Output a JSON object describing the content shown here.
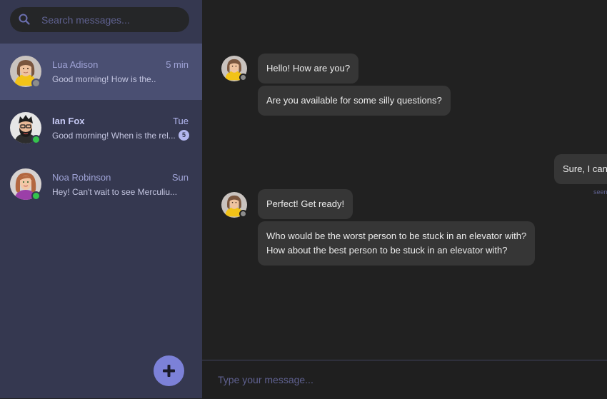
{
  "search": {
    "placeholder": "Search messages..."
  },
  "conversations": [
    {
      "name": "Lua Adison",
      "snippet": "Good morning! How is the..",
      "time": "5 min",
      "status": "offline",
      "unread": ""
    },
    {
      "name": "Ian Fox",
      "snippet": "Good morning! When is the rel...",
      "time": "Tue",
      "status": "online",
      "unread": "5"
    },
    {
      "name": "Noa Robinson",
      "snippet": "Hey! Can't wait to see Merculiu...",
      "time": "Sun",
      "status": "online",
      "unread": ""
    }
  ],
  "messages": [
    {
      "sender": "incoming",
      "text": "Hello! How are you?"
    },
    {
      "sender": "incoming",
      "text": "Are you available for some silly questions?"
    },
    {
      "sender": "outgoing",
      "text": "Sure, I can"
    },
    {
      "sender": "incoming",
      "text": "Perfect! Get ready!"
    },
    {
      "sender": "incoming",
      "lines": [
        "Who would be the worst person to be stuck in an elevator with?",
        "How about the best person to be stuck in an elevator with?"
      ]
    }
  ],
  "seen_label": "seen",
  "composer": {
    "placeholder": "Type your message..."
  },
  "icons": {
    "search": "search-icon",
    "new_chat": "plus-icon"
  },
  "colors": {
    "sidebar": "#353850",
    "active_conversation": "#4a4f72",
    "accent": "#7c81d8",
    "online": "#35c44d",
    "offline": "#8c8c8c",
    "chat_background": "#212121",
    "bubble": "#363636"
  }
}
